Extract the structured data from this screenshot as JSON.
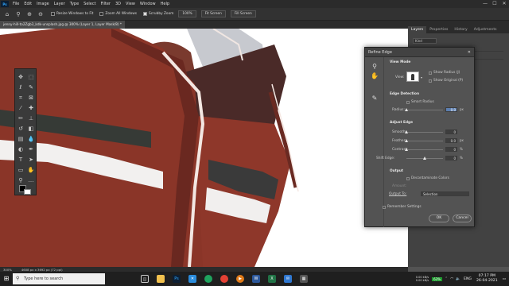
{
  "menubar": {
    "logo": "Ps",
    "items": [
      "File",
      "Edit",
      "Image",
      "Layer",
      "Type",
      "Select",
      "Filter",
      "3D",
      "View",
      "Window",
      "Help"
    ],
    "minimize": "—",
    "maximize": "☐",
    "close": "✕"
  },
  "options": {
    "resize_windows": "Resize Windows to Fit",
    "zoom_all": "Zoom All Windows",
    "scrubby_zoom": "Scrubby Zoom",
    "zoom_100": "100%",
    "fit_screen": "Fit Screen",
    "fill_screen": "Fill Screen"
  },
  "document": {
    "tab_title": "jenny-hill-to2Zgb3_kdk-unsplash.jpg @ 300% (Layer 1, Layer Mask/8) *",
    "zoom": "300%",
    "doc_info": "4608 px x 3692 px (72 ppi)"
  },
  "panels": {
    "tabs": [
      "Layers",
      "Properties",
      "History",
      "Adjustments"
    ],
    "kind": "Kind"
  },
  "refine_edge": {
    "title": "Refine Edge",
    "close": "✕",
    "view_mode": {
      "section": "View Mode",
      "view_label": "View:",
      "show_radius": "Show Radius (J)",
      "show_original": "Show Original (P)"
    },
    "edge_detection": {
      "section": "Edge Detection",
      "smart_radius": "Smart Radius",
      "radius_label": "Radius:",
      "radius_value": "0.0",
      "radius_unit": "px",
      "radius_level": 0.0
    },
    "adjust_edge": {
      "section": "Adjust Edge",
      "smooth_label": "Smooth:",
      "smooth_value": "0",
      "smooth_level": 0.0,
      "feather_label": "Feather:",
      "feather_value": "0.0",
      "feather_unit": "px",
      "feather_level": 0.0,
      "contrast_label": "Contrast:",
      "contrast_value": "0",
      "contrast_unit": "%",
      "contrast_level": 0.0,
      "shift_label": "Shift Edge:",
      "shift_value": "0",
      "shift_unit": "%",
      "shift_level": 0.5
    },
    "output": {
      "section": "Output",
      "decontaminate": "Decontaminate Colors",
      "amount_label": "Amount:",
      "output_to_label": "Output To:",
      "output_to_value": "Selection"
    },
    "remember": "Remember Settings",
    "ok": "OK",
    "cancel": "Cancel"
  },
  "taskbar": {
    "search_placeholder": "Type here to search",
    "language": "ENG",
    "time": "07:17 PM",
    "date": "26-04-2021",
    "net_up": "0.00 kB/s",
    "net_down": "0.00 kB/s",
    "battery": "63%"
  }
}
